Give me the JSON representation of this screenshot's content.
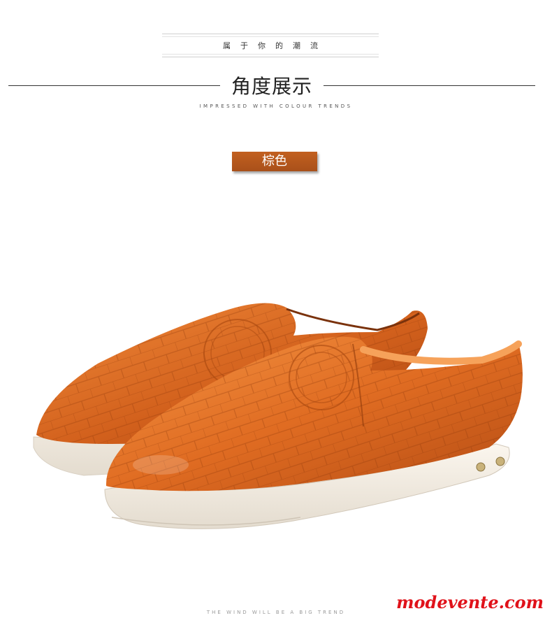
{
  "header": {
    "tagline": "属于你的潮流",
    "title": "角度展示",
    "subtitle": "IMPRESSED WITH COLOUR TRENDS"
  },
  "color_badge": {
    "label": "棕色"
  },
  "product": {
    "image_icon": "brown-leather-loafer-pair",
    "accent": "#d9641e"
  },
  "footer": {
    "text": "THE WIND WILL BE A BIG TREND"
  },
  "watermark": {
    "text": "modevente.com"
  }
}
